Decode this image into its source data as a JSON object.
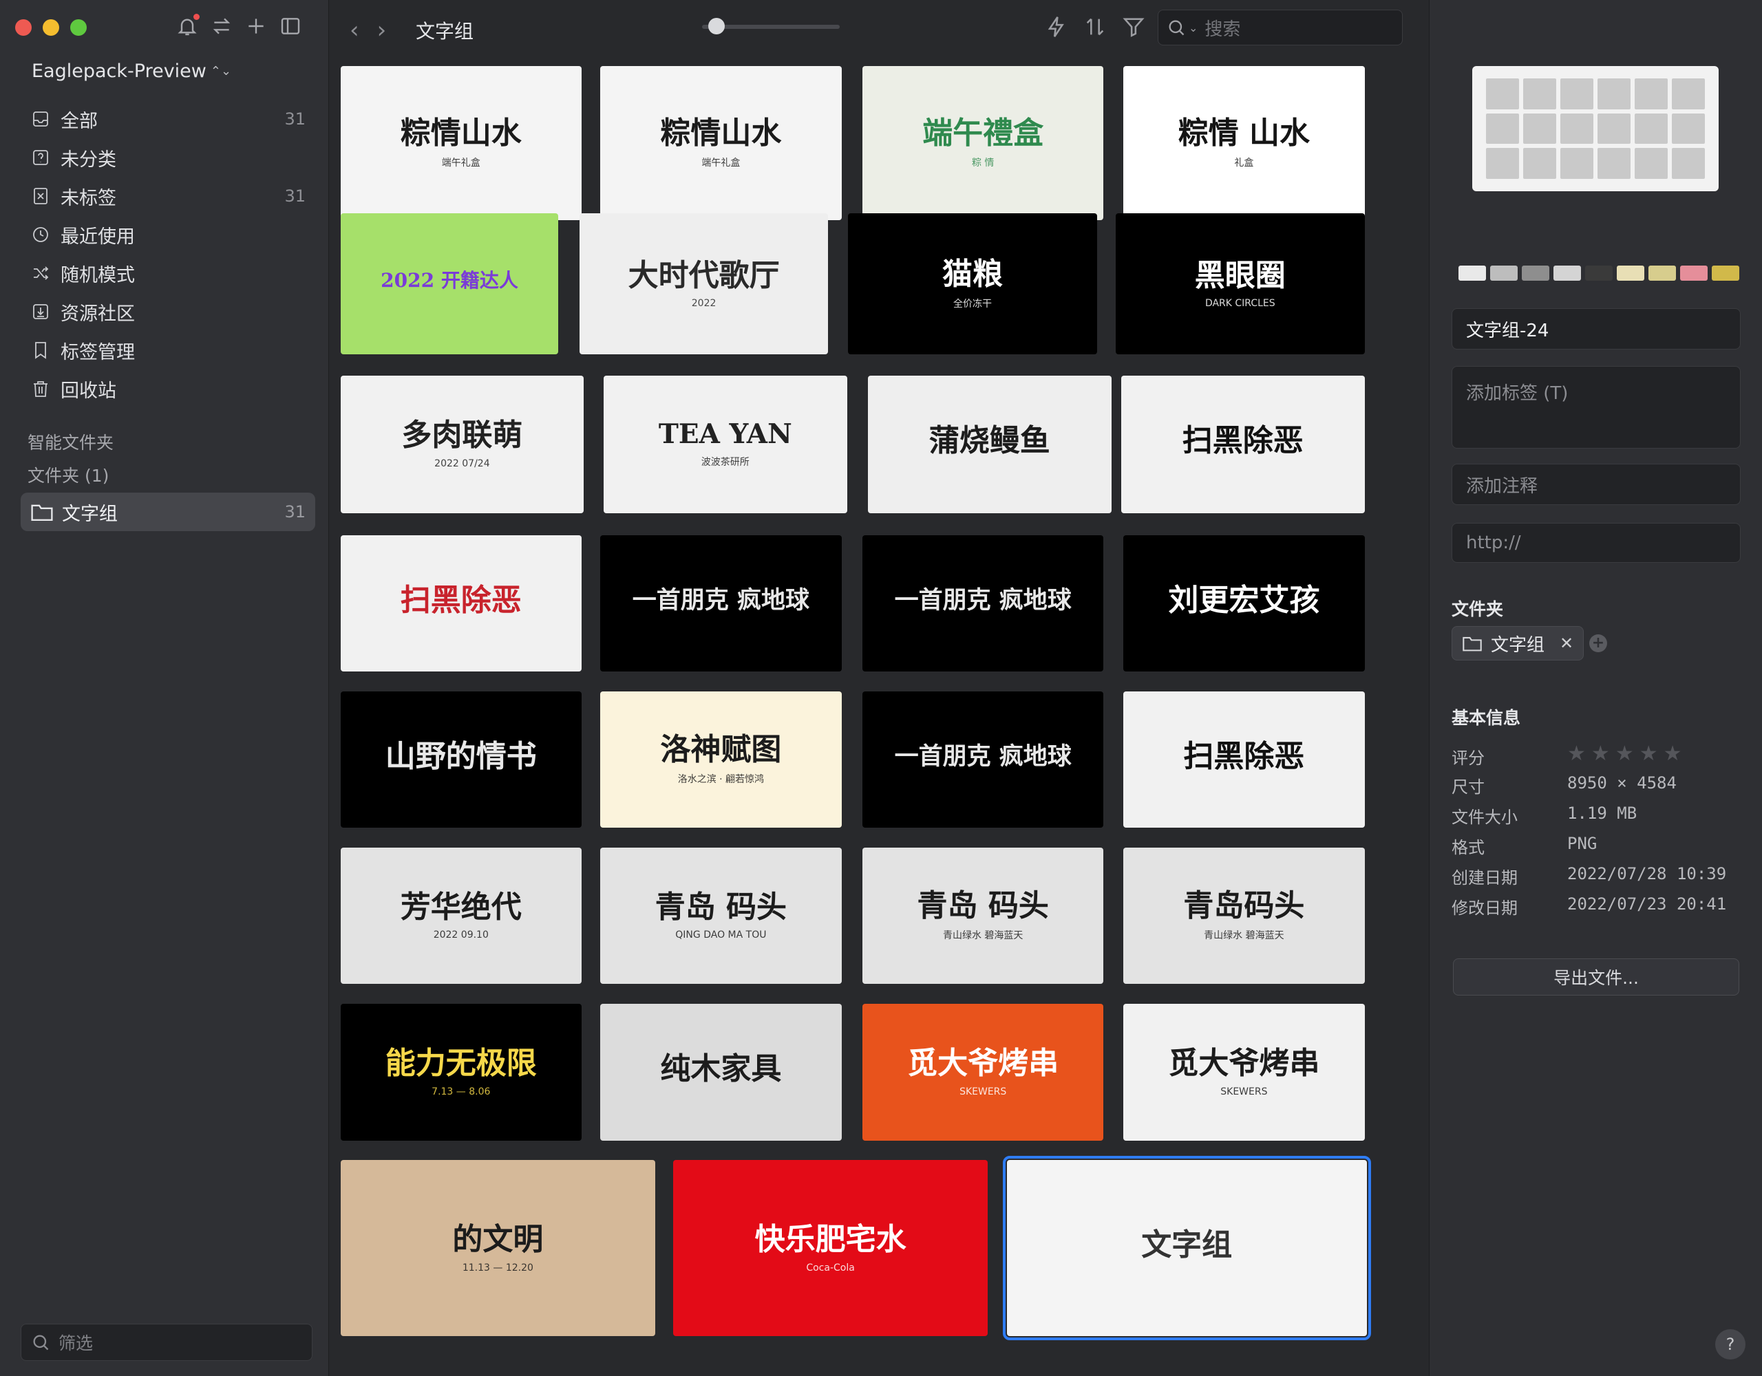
{
  "sidebar": {
    "library_name": "Eaglepack-Preview",
    "items": [
      {
        "label": "全部",
        "count": "31",
        "icon": "inbox-icon"
      },
      {
        "label": "未分类",
        "count": "",
        "icon": "question-box-icon"
      },
      {
        "label": "未标签",
        "count": "31",
        "icon": "tag-off-icon"
      },
      {
        "label": "最近使用",
        "count": "",
        "icon": "clock-icon"
      },
      {
        "label": "随机模式",
        "count": "",
        "icon": "shuffle-icon"
      },
      {
        "label": "资源社区",
        "count": "",
        "icon": "download-box-icon"
      },
      {
        "label": "标签管理",
        "count": "",
        "icon": "bookmark-icon"
      },
      {
        "label": "回收站",
        "count": "",
        "icon": "trash-icon"
      }
    ],
    "smart_folders_title": "智能文件夹",
    "folders_title": "文件夹 (1)",
    "active_folder": {
      "label": "文字组",
      "count": "31"
    },
    "filter_placeholder": "筛选"
  },
  "toolbar": {
    "breadcrumb": "文字组",
    "search_placeholder": "搜索",
    "thumbnail_size_level": 0.05
  },
  "grid_rows": [
    [
      {
        "title": "粽情山水",
        "sub": "端午礼盒",
        "bg": "#f4f4f4",
        "fg": "#1b1b1b"
      },
      {
        "title": "粽情山水",
        "sub": "端午礼盒",
        "bg": "#f4f4f4",
        "fg": "#1b1b1b"
      },
      {
        "title": "端午禮盒",
        "sub": "粽 情",
        "bg": "#eceee6",
        "fg": "#2f8a4e"
      },
      {
        "title": "粽情 山水",
        "sub": "礼盒",
        "bg": "#ffffff",
        "fg": "#151515"
      }
    ],
    [
      {
        "title": "2022 开籍达人",
        "sub": "",
        "bg": "#a6e06a",
        "fg": "#7a3bd8"
      },
      {
        "title": "大时代歌厅",
        "sub": "2022",
        "bg": "#eeeeee",
        "fg": "#2a2a2a"
      },
      {
        "title": "猫粮",
        "sub": "全价冻干",
        "bg": "#000000",
        "fg": "#ffffff"
      },
      {
        "title": "黑眼圈",
        "sub": "DARK CIRCLES",
        "bg": "#000000",
        "fg": "#ffffff"
      }
    ],
    [
      {
        "title": "多肉联萌",
        "sub": "2022 07/24",
        "bg": "#f1f1f1",
        "fg": "#222222"
      },
      {
        "title": "TEA YAN",
        "sub": "波波茶研所",
        "bg": "#f1f1f1",
        "fg": "#222222"
      },
      {
        "title": "蒲烧鳗鱼",
        "sub": "",
        "bg": "#eeeeee",
        "fg": "#1c1c1c"
      },
      {
        "title": "扫黑除恶",
        "sub": "",
        "bg": "#f1f1f1",
        "fg": "#111111"
      }
    ],
    [
      {
        "title": "扫黑除恶",
        "sub": "",
        "bg": "#f1f1f1",
        "fg": "#c8232c"
      },
      {
        "title": "一首朋克 疯地球",
        "sub": "",
        "bg": "#000000",
        "fg": "#e8e8e8"
      },
      {
        "title": "一首朋克 疯地球",
        "sub": "",
        "bg": "#000000",
        "fg": "#e8e8e8"
      },
      {
        "title": "刘更宏艾孩",
        "sub": "",
        "bg": "#000000",
        "fg": "#ffffff"
      }
    ],
    [
      {
        "title": "山野的情书",
        "sub": "",
        "bg": "#000000",
        "fg": "#e8e8e8"
      },
      {
        "title": "洛神赋图",
        "sub": "洛水之滨 · 翩若惊鸿",
        "bg": "#fbf3dc",
        "fg": "#1c1c1c"
      },
      {
        "title": "一首朋克 疯地球",
        "sub": "",
        "bg": "#000000",
        "fg": "#e8e8e8"
      },
      {
        "title": "扫黑除恶",
        "sub": "",
        "bg": "#f1f1f1",
        "fg": "#111111"
      }
    ],
    [
      {
        "title": "芳华绝代",
        "sub": "2022 09.10",
        "bg": "#e3e3e3",
        "fg": "#1c1c1c"
      },
      {
        "title": "青岛 码头",
        "sub": "QING DAO MA TOU",
        "bg": "#e3e3e3",
        "fg": "#1c1c1c"
      },
      {
        "title": "青岛 码头",
        "sub": "青山绿水 碧海蓝天",
        "bg": "#e3e3e3",
        "fg": "#1c1c1c"
      },
      {
        "title": "青岛码头",
        "sub": "青山绿水 碧海蓝天",
        "bg": "#e3e3e3",
        "fg": "#1c1c1c"
      }
    ],
    [
      {
        "title": "能力无极限",
        "sub": "7.13 — 8.06",
        "bg": "#000000",
        "fg": "#f6d84a"
      },
      {
        "title": "纯木家具",
        "sub": "",
        "bg": "#dcdcdc",
        "fg": "#1c1c1c"
      },
      {
        "title": "觅大爷烤串",
        "sub": "SKEWERS",
        "bg": "#e8531c",
        "fg": "#ffffff"
      },
      {
        "title": "觅大爷烤串",
        "sub": "SKEWERS",
        "bg": "#f1f1f1",
        "fg": "#1c1c1c"
      }
    ],
    [
      {
        "title": "的文明",
        "sub": "11.13 — 12.20",
        "bg": "#d5b999",
        "fg": "#1c1c1c"
      },
      {
        "title": "快乐肥宅水",
        "sub": "Coca-Cola",
        "bg": "#e30b17",
        "fg": "#ffffff"
      },
      {
        "title": "文字组",
        "sub": "",
        "bg": "#f4f4f4",
        "fg": "#333333"
      }
    ]
  ],
  "inspector": {
    "palette": [
      "#e9e9e9",
      "#bdbdbd",
      "#8e8e8e",
      "#d4d4d4",
      "#3a3a3a",
      "#e8dfb5",
      "#d7cd8d",
      "#e58e9a",
      "#d1b94a"
    ],
    "name": "文字组-24",
    "tags_placeholder": "添加标签 (T)",
    "note_placeholder": "添加注释",
    "url_placeholder": "http://",
    "folder_title": "文件夹",
    "folder_chip": "文字组",
    "info_title": "基本信息",
    "rating_label": "评分",
    "rating": 0,
    "rows": [
      {
        "k": "尺寸",
        "v": "8950 × 4584"
      },
      {
        "k": "文件大小",
        "v": "1.19 MB"
      },
      {
        "k": "格式",
        "v": "PNG"
      },
      {
        "k": "创建日期",
        "v": "2022/07/28 10:39"
      },
      {
        "k": "修改日期",
        "v": "2022/07/23 20:41"
      }
    ],
    "export_label": "导出文件...",
    "help_label": "?"
  }
}
